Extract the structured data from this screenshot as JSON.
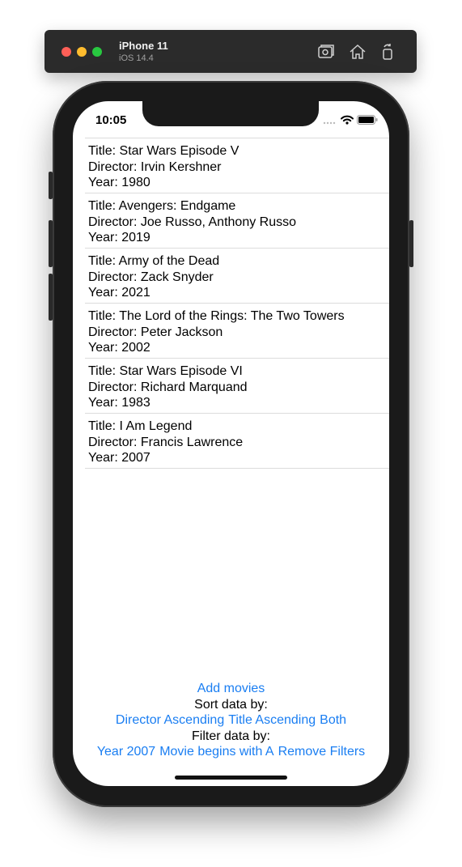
{
  "simulator": {
    "device_name": "iPhone 11",
    "os_version": "iOS 14.4",
    "icons": [
      "screenshot-icon",
      "home-icon",
      "rotate-icon"
    ]
  },
  "status_bar": {
    "time": "10:05",
    "icons": [
      "signal-icon",
      "wifi-icon",
      "battery-icon"
    ]
  },
  "movies": [
    {
      "title": "Title: Star Wars Episode V",
      "director": "Director: Irvin Kershner",
      "year": "Year: 1980"
    },
    {
      "title": "Title: Avengers: Endgame",
      "director": "Director: Joe Russo, Anthony Russo",
      "year": "Year: 2019"
    },
    {
      "title": "Title: Army of the Dead",
      "director": "Director: Zack Snyder",
      "year": "Year: 2021"
    },
    {
      "title": "Title: The Lord of the Rings: The Two Towers",
      "director": "Director: Peter Jackson",
      "year": "Year: 2002"
    },
    {
      "title": "Title: Star Wars Episode VI",
      "director": "Director: Richard Marquand",
      "year": "Year: 1983"
    },
    {
      "title": "Title: I Am Legend",
      "director": "Director: Francis Lawrence",
      "year": "Year: 2007"
    }
  ],
  "controls": {
    "add_movies": "Add movies",
    "sort_label": "Sort data by:",
    "sort_options": [
      "Director Ascending",
      "Title Ascending",
      "Both"
    ],
    "filter_label": "Filter data by:",
    "filter_options": [
      "Year 2007",
      "Movie begins with A",
      "Remove Filters"
    ]
  },
  "colors": {
    "link": "#1a7ef2",
    "divider": "#dcdcdc",
    "device_frame": "#1a1a1a"
  }
}
